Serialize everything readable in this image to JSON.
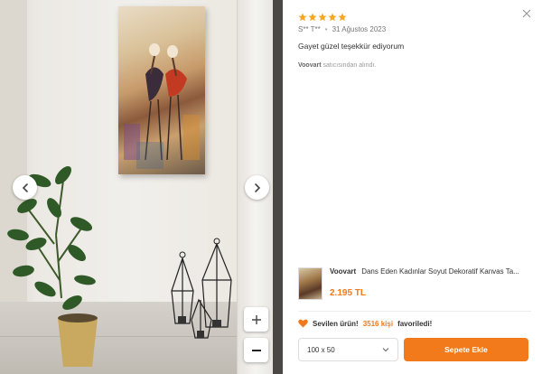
{
  "review": {
    "rating": 5,
    "author": "S** T**",
    "date": "31 Ağustos 2023",
    "comment": "Gayet güzel teşekkür ediyorum",
    "seller_name": "Voovart",
    "seller_suffix": "satıcısından alındı."
  },
  "product": {
    "brand": "Voovart",
    "title": "Dans Eden Kadınlar Soyut Dekoratif Kanvas Ta...",
    "price": "2.195 TL"
  },
  "favorite": {
    "label": "Sevilen ürün!",
    "count": "3516 kişi",
    "suffix": "favoriledi!"
  },
  "size_select": {
    "value": "100 x 50"
  },
  "cart_button": {
    "label": "Sepete Ekle"
  },
  "colors": {
    "accent": "#f27a1a",
    "star": "#f5a623"
  },
  "icons": [
    "chevron-left-icon",
    "chevron-right-icon",
    "zoom-in-icon",
    "zoom-out-icon",
    "close-icon",
    "star-icon",
    "heart-icon",
    "chevron-down-icon"
  ]
}
